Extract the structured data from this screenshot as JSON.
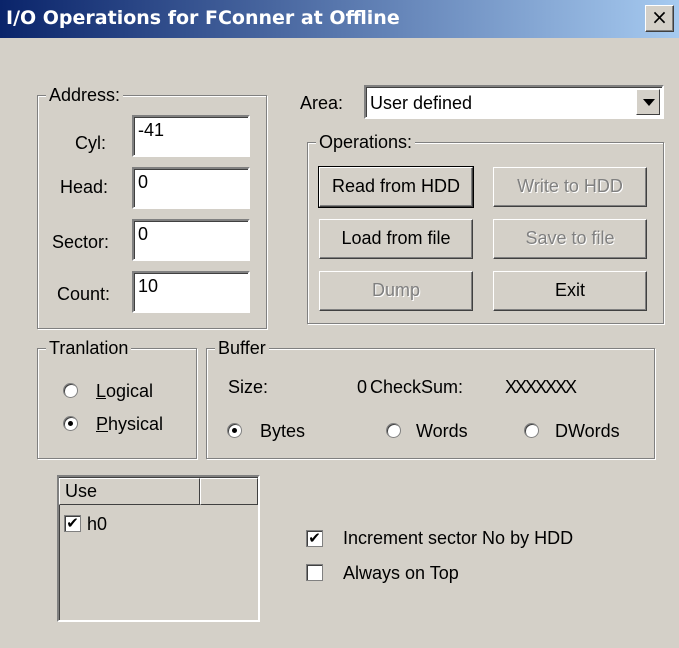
{
  "window": {
    "title": "I/O Operations for FConner at Offline",
    "close_label": "×"
  },
  "address": {
    "legend": "Address:",
    "cyl_label": "Cyl:",
    "cyl_value": "-41",
    "head_label": "Head:",
    "head_value": "0",
    "sector_label": "Sector:",
    "sector_value": "0",
    "count_label": "Count:",
    "count_value": "10"
  },
  "area": {
    "label": "Area:",
    "selected": "User defined"
  },
  "operations": {
    "legend": "Operations:",
    "read_from_hdd": "Read from HDD",
    "write_to_hdd": "Write to HDD",
    "load_from_file": "Load from file",
    "save_to_file": "Save to file",
    "dump": "Dump",
    "exit": "Exit"
  },
  "translation": {
    "legend": "Tranlation",
    "logical_first": "L",
    "logical_rest": "ogical",
    "physical_first": "P",
    "physical_rest": "hysical",
    "selected": "Physical"
  },
  "buffer": {
    "legend": "Buffer",
    "size_label": "Size:",
    "size_value": "0",
    "checksum_label": "CheckSum:",
    "checksum_value": "XXXXXXX",
    "bytes_label": "Bytes",
    "words_label": "Words",
    "dwords_label": "DWords",
    "selected": "Bytes"
  },
  "use_list": {
    "columns": [
      "Use",
      ""
    ],
    "items": [
      {
        "label": "h0",
        "checked": true
      }
    ]
  },
  "options": {
    "increment_label": "Increment sector No by HDD",
    "increment_checked": true,
    "always_on_top_label": "Always on Top",
    "always_on_top_checked": false
  },
  "icons": {
    "close": "close-icon",
    "dropdown": "chevron-down-icon",
    "check": "✔"
  }
}
